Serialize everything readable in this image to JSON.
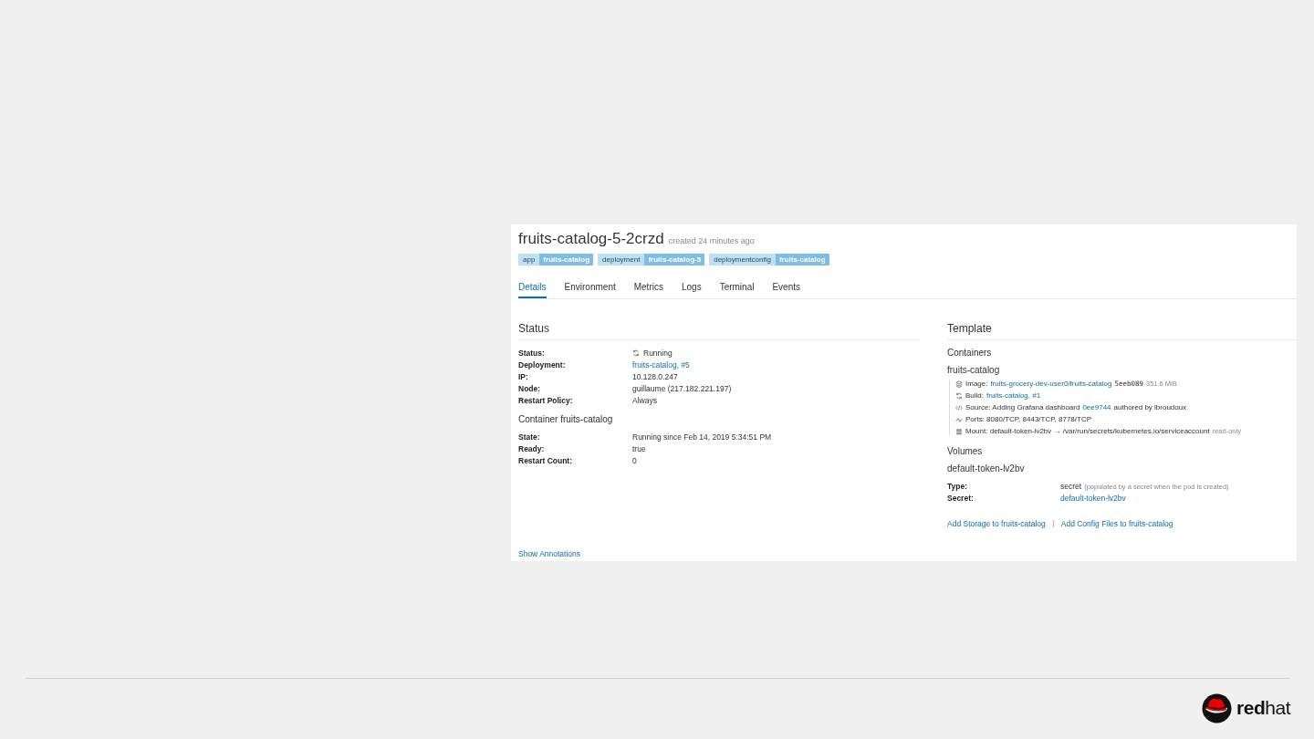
{
  "pod": {
    "name": "fruits-catalog-5-2crzd",
    "created": "created 24 minutes ago",
    "labels": [
      {
        "key": "app",
        "value": "fruits-catalog"
      },
      {
        "key": "deployment",
        "value": "fruits-catalog-5"
      },
      {
        "key": "deploymentconfig",
        "value": "fruits-catalog"
      }
    ]
  },
  "tabs": [
    {
      "label": "Details",
      "selected": true
    },
    {
      "label": "Environment",
      "selected": false
    },
    {
      "label": "Metrics",
      "selected": false
    },
    {
      "label": "Logs",
      "selected": false
    },
    {
      "label": "Terminal",
      "selected": false
    },
    {
      "label": "Events",
      "selected": false
    }
  ],
  "status": {
    "title": "Status",
    "rows": [
      {
        "label": "Status:",
        "value": "Running",
        "kind": "status"
      },
      {
        "label": "Deployment:",
        "value": "fruits-catalog, #5",
        "kind": "link"
      },
      {
        "label": "IP:",
        "value": "10.128.0.247",
        "kind": "text"
      },
      {
        "label": "Node:",
        "value": "guillaume (217.182.221.197)",
        "kind": "text"
      },
      {
        "label": "Restart Policy:",
        "value": "Always",
        "kind": "text"
      }
    ]
  },
  "container": {
    "title": "Container fruits-catalog",
    "rows": [
      {
        "label": "State:",
        "value": "Running since Feb 14, 2019 5:34:51 PM"
      },
      {
        "label": "Ready:",
        "value": "true"
      },
      {
        "label": "Restart Count:",
        "value": "0"
      }
    ]
  },
  "show_annotations": "Show Annotations",
  "template": {
    "title": "Template",
    "containers_title": "Containers",
    "container_name": "fruits-catalog",
    "items": [
      {
        "kind": "image",
        "parts": [
          {
            "text": "Image:",
            "kind": "plain"
          },
          {
            "text": "fruits-grocery-dev-user0/fruits-catalog",
            "kind": "link"
          },
          {
            "text": "5eeb089",
            "kind": "mono"
          },
          {
            "text": "351.6 MiB",
            "kind": "muted"
          }
        ]
      },
      {
        "kind": "build",
        "parts": [
          {
            "text": "Build:",
            "kind": "plain"
          },
          {
            "text": "fruits-catalog, #1",
            "kind": "link"
          }
        ]
      },
      {
        "kind": "source",
        "parts": [
          {
            "text": "Source: Adding Grafana dashboard",
            "kind": "plain"
          },
          {
            "text": "0ee9744",
            "kind": "link"
          },
          {
            "text": "authored by lbroudoux",
            "kind": "plain"
          }
        ]
      },
      {
        "kind": "ports",
        "parts": [
          {
            "text": "Ports: 8080/TCP, 8443/TCP, 8778/TCP",
            "kind": "plain"
          }
        ]
      },
      {
        "kind": "mount",
        "parts": [
          {
            "text": "Mount: default-token-lv2bv → /var/run/secrets/kubernetes.io/serviceaccount",
            "kind": "plain"
          },
          {
            "text": "read-only",
            "kind": "muted"
          }
        ]
      }
    ]
  },
  "volumes": {
    "title": "Volumes",
    "name": "default-token-lv2bv",
    "rows": [
      {
        "label": "Type:",
        "parts": [
          {
            "text": "secret",
            "kind": "plain"
          },
          {
            "text": "(populated by a secret when the pod is created)",
            "kind": "muted"
          }
        ]
      },
      {
        "label": "Secret:",
        "parts": [
          {
            "text": "default-token-lv2bv",
            "kind": "link"
          }
        ]
      }
    ]
  },
  "actions": [
    {
      "label": "Add Storage to fruits-catalog"
    },
    {
      "label": "Add Config Files to fruits-catalog"
    }
  ],
  "brand": {
    "logo_text": "**red**hat"
  }
}
